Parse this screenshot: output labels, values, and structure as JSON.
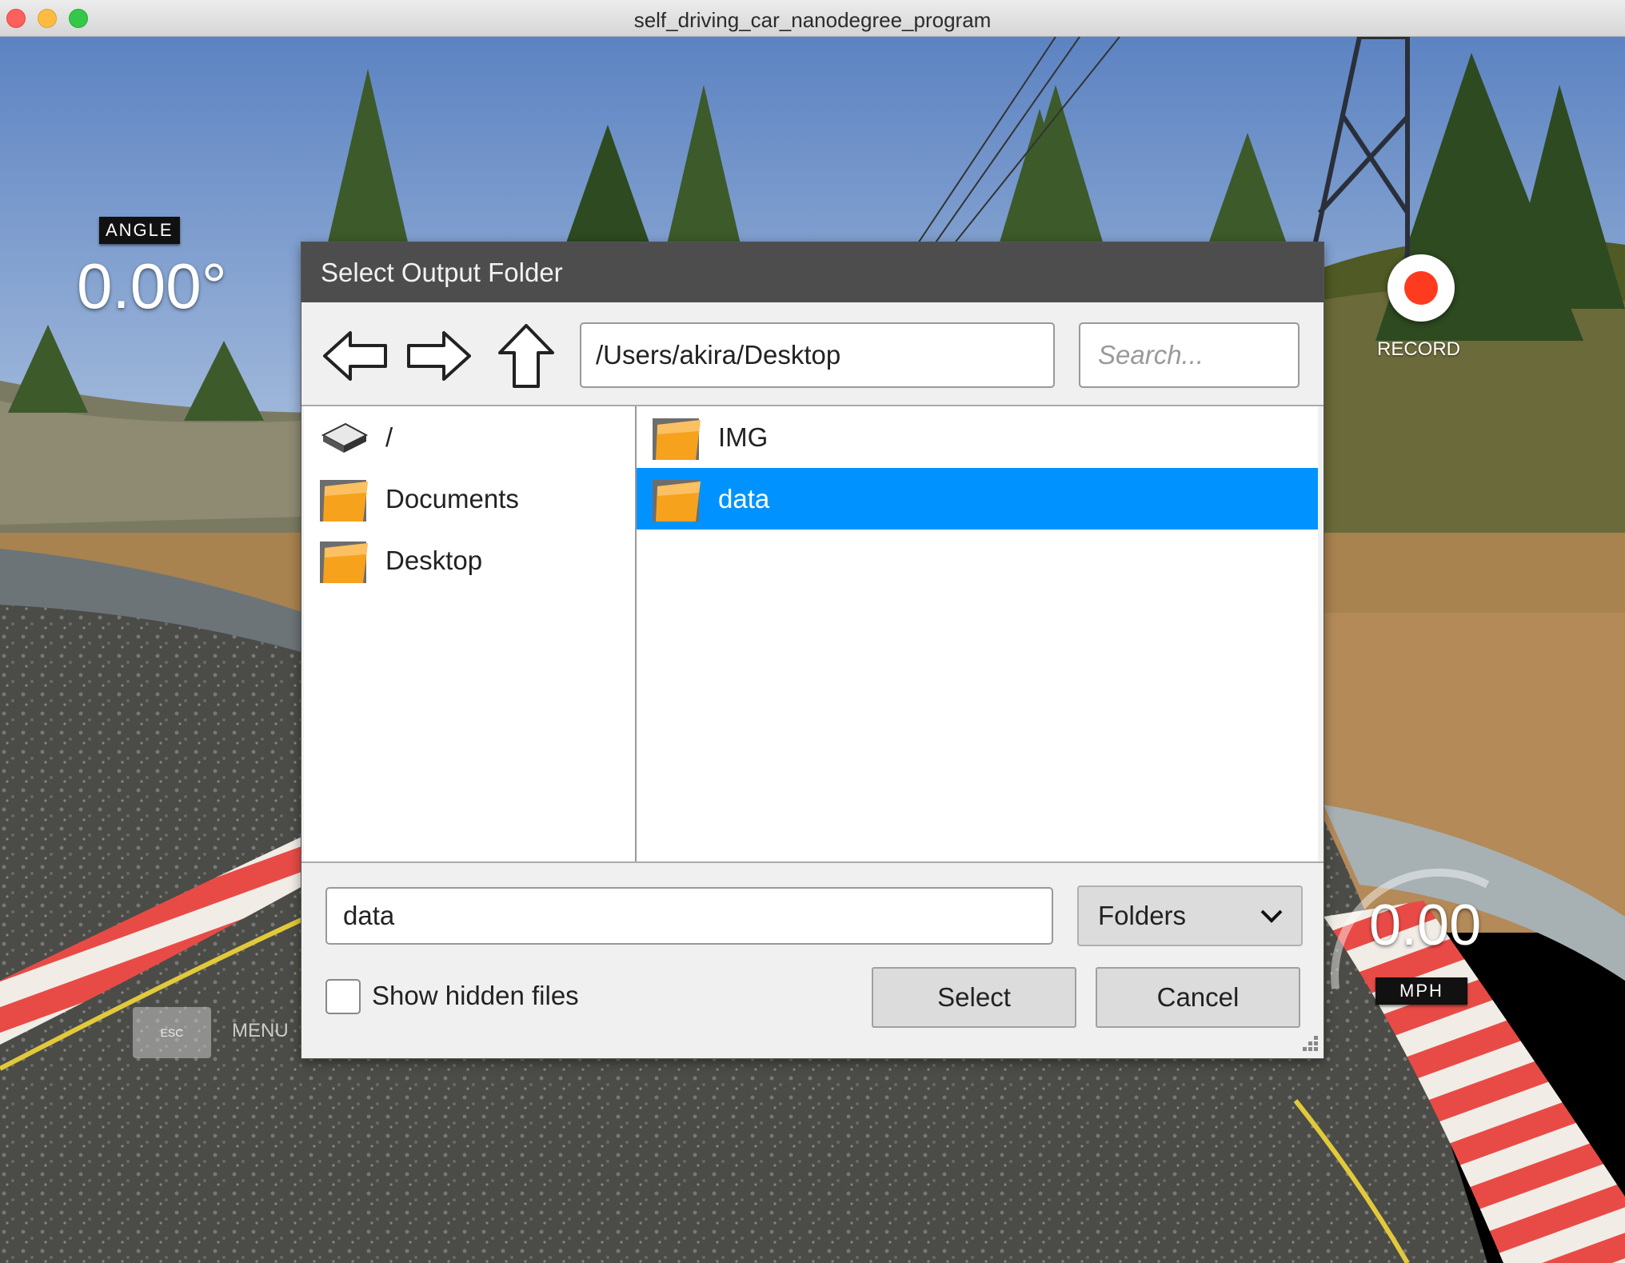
{
  "window": {
    "title": "self_driving_car_nanodegree_program"
  },
  "hud": {
    "angle_label": "ANGLE",
    "angle_value": "0.00°",
    "record_label": "RECORD",
    "speed_value": "0.00",
    "speed_unit": "MPH",
    "esc_key": "ESC",
    "menu_label": "MENU"
  },
  "dialog": {
    "title": "Select Output Folder",
    "path": "/Users/akira/Desktop",
    "search_placeholder": "Search...",
    "sidebar": [
      {
        "label": "/",
        "icon": "drive-icon"
      },
      {
        "label": "Documents",
        "icon": "folder-icon"
      },
      {
        "label": "Desktop",
        "icon": "folder-icon"
      }
    ],
    "files": [
      {
        "label": "IMG",
        "icon": "folder-icon",
        "selected": false
      },
      {
        "label": "data",
        "icon": "folder-icon",
        "selected": true
      }
    ],
    "filename": "data",
    "filter": "Folders",
    "show_hidden_label": "Show hidden files",
    "show_hidden_checked": false,
    "select_label": "Select",
    "cancel_label": "Cancel"
  },
  "colors": {
    "selection": "#0093ff",
    "dialog_title_bg": "#4d4d4d",
    "record_red": "#ff3b1f",
    "folder_orange": "#f7a21d"
  }
}
